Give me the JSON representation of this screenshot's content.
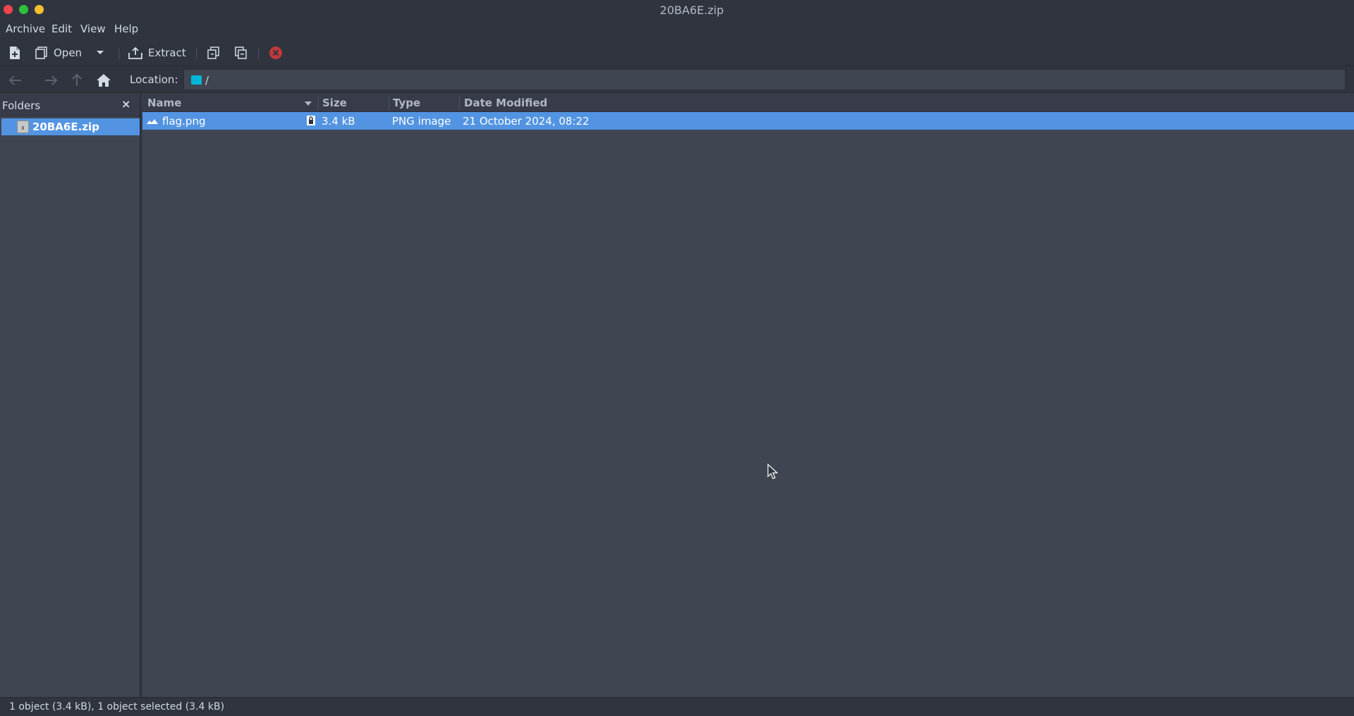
{
  "window": {
    "title": "20BA6E.zip"
  },
  "menubar": {
    "items": [
      "Archive",
      "Edit",
      "View",
      "Help"
    ]
  },
  "toolbar": {
    "new_icon": "new-archive-icon",
    "open_label": "Open",
    "extract_label": "Extract",
    "add_files_icon": "add-files-icon",
    "add_folder_icon": "add-folder-icon",
    "stop_icon": "stop-icon",
    "accent_stop": "#c03a3a"
  },
  "location": {
    "label": "Location:",
    "value": "/"
  },
  "sidebar": {
    "title": "Folders",
    "close_glyph": "×",
    "items": [
      {
        "label": "20BA6E.zip",
        "selected": true
      }
    ]
  },
  "filelist": {
    "columns": [
      "Name",
      "Size",
      "Type",
      "Date Modified"
    ],
    "sort_column": "Name",
    "rows": [
      {
        "name": "flag.png",
        "encrypted": true,
        "size": "3.4 kB",
        "type": "PNG image",
        "modified": "21 October 2024, 08:22",
        "selected": true
      }
    ]
  },
  "status": {
    "text": "1 object (3.4 kB), 1 object selected (3.4 kB)"
  },
  "colors": {
    "selection": "#5294e2",
    "background": "#383c4a",
    "panel": "#404552",
    "titlebar": "#2f343f"
  }
}
